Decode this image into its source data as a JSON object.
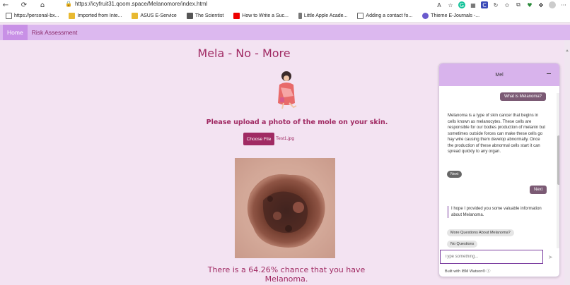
{
  "browser": {
    "url": "https://icyfruit31.qoom.space/Melanomore/index.html",
    "bookmarks": [
      {
        "label": "https://personal-bx...",
        "icon": "page-icon"
      },
      {
        "label": "Imported from Inte...",
        "icon": "folder-icon"
      },
      {
        "label": "ASUS E-Service",
        "icon": "folder-icon"
      },
      {
        "label": "The Scientist",
        "icon": "ts-icon"
      },
      {
        "label": "How to Write a Suc...",
        "icon": "youtube-icon"
      },
      {
        "label": "Little Apple Acade...",
        "icon": "feather-icon"
      },
      {
        "label": "Adding a contact fo...",
        "icon": "page-icon"
      },
      {
        "label": "Thieme E-Journals -...",
        "icon": "thieme-icon"
      }
    ]
  },
  "nav": {
    "home": "Home",
    "risk": "Risk Assessment"
  },
  "main": {
    "title": "Mela - No - More",
    "prompt": "Please upload a photo of the mole on your skin.",
    "choose_file": "Choose File",
    "filename": "Test1.jpg",
    "result": "There is a 64.26% chance that you have Melanoma."
  },
  "chat": {
    "name": "Mel",
    "user_q1": "What is Melanoma?",
    "bot_a1": "Melanoma is a type of skin cancer that begins in cells known as melanocytes. These cells are responsible for our bodies production of melanin but sometimes outside forces can make these cells go hay wire causing them develop abnormally. Once the production of these abnormal cells start it can spread quickly to any organ.",
    "next_chip": "Next",
    "user_next": "Next",
    "bot_a2": "I hope I provided you some valuable information about Melanoma.",
    "option1": "More Questions About Melanoma?",
    "option2": "No Questions",
    "input_placeholder": "Type something...",
    "powered_by": "Built with IBM Watson®"
  },
  "colors": {
    "accent": "#a02a63",
    "nav_bg": "#dcb8ef",
    "page_bg": "#f3e3f2"
  }
}
